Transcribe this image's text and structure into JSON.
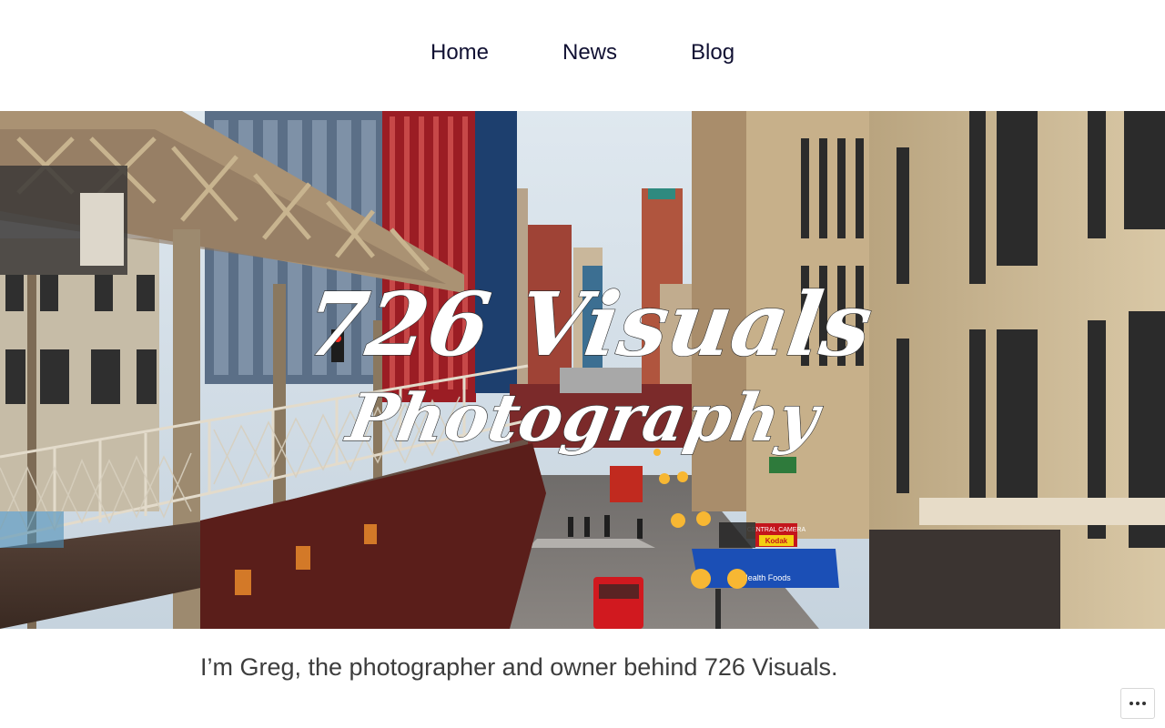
{
  "nav": {
    "items": [
      {
        "label": "Home"
      },
      {
        "label": "News"
      },
      {
        "label": "Blog"
      }
    ]
  },
  "hero": {
    "title_line1": "726 Visuals",
    "title_line2": "Photography",
    "signs": {
      "central_camera": "CENTRAL CAMERA",
      "kodak": "Kodak",
      "health_foods": "Health Foods"
    }
  },
  "intro": {
    "text": "I’m Greg, the photographer and owner behind 726 Visuals."
  },
  "colors": {
    "nav_text": "#111133",
    "body_text": "#3d3d3d",
    "awning_blue": "#1b4fb6",
    "brick_red": "#9b1d24"
  },
  "icons": {
    "more": "ellipsis-icon"
  }
}
